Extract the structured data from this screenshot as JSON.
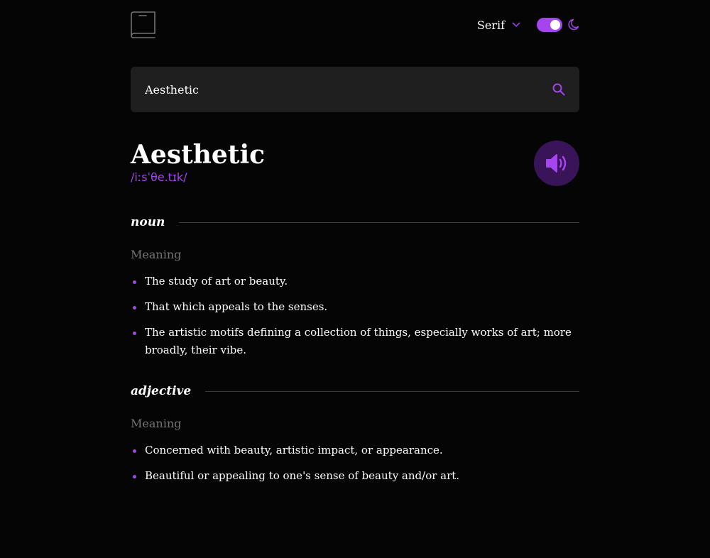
{
  "header": {
    "font_select": {
      "selected": "Serif"
    },
    "theme_toggle": {
      "dark_mode": true
    }
  },
  "search": {
    "value": "Aesthetic",
    "placeholder": ""
  },
  "entry": {
    "word": "Aesthetic",
    "phonetic": "/iːsˈθe.tɪk/",
    "meanings": [
      {
        "part_of_speech": "noun",
        "label": "Meaning",
        "definitions": [
          "The study of art or beauty.",
          "That which appeals to the senses.",
          "The artistic motifs defining a collection of things, especially works of art; more broadly, their vibe."
        ]
      },
      {
        "part_of_speech": "adjective",
        "label": "Meaning",
        "definitions": [
          "Concerned with beauty, artistic impact, or appearance.",
          "Beautiful or appealing to one's sense of beauty and/or art."
        ]
      }
    ]
  },
  "icons": {
    "logo": "book-icon",
    "chevron": "chevron-down-icon",
    "moon": "moon-icon",
    "search": "search-icon",
    "play": "speaker-icon"
  },
  "colors": {
    "accent": "#a445ed",
    "background": "#050505",
    "surface": "#1f1f1f",
    "muted": "#757575",
    "play_bg": "#3a1458"
  }
}
